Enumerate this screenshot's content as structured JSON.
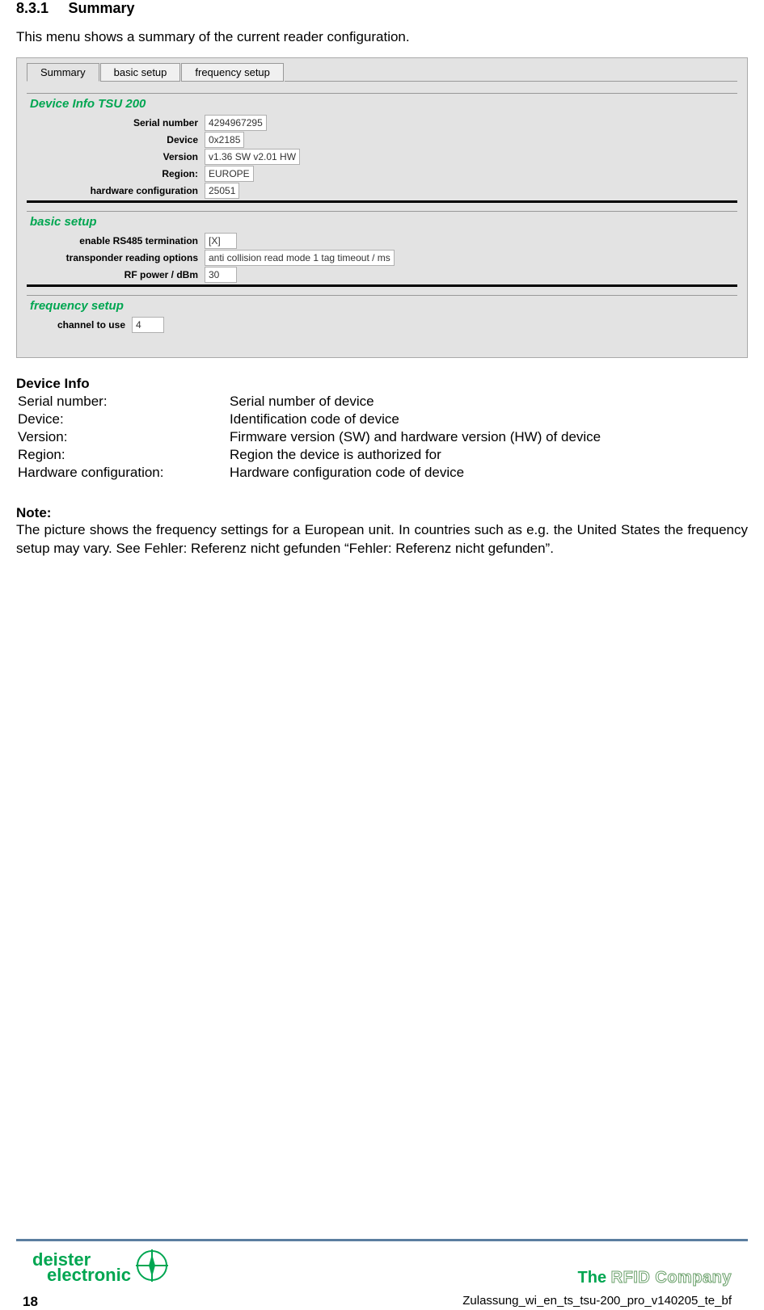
{
  "section": {
    "number": "8.3.1",
    "title": "Summary",
    "intro": "This menu shows a summary of the current reader configuration."
  },
  "tabs": {
    "summary": "Summary",
    "basic": "basic setup",
    "freq": "frequency setup"
  },
  "device_info": {
    "title": "Device Info TSU 200",
    "rows": {
      "serial_label": "Serial number",
      "serial_val": "4294967295",
      "device_label": "Device",
      "device_val": "0x2185",
      "version_label": "Version",
      "version_val": "v1.36 SW v2.01 HW",
      "region_label": "Region:",
      "region_val": "EUROPE",
      "hw_label": "hardware configuration",
      "hw_val": "25051"
    }
  },
  "basic_setup": {
    "title": "basic setup",
    "rows": {
      "rs485_label": "enable RS485 termination",
      "rs485_val": "[X]",
      "trans_label": "transponder reading options",
      "trans_val": "anti collision read mode 1 tag timeout / ms",
      "rf_label": "RF power / dBm",
      "rf_val": "30"
    }
  },
  "freq_setup": {
    "title": "frequency setup",
    "channel_label": "channel to use",
    "channel_val": "4"
  },
  "defs": {
    "heading": "Device Info",
    "rows": [
      {
        "label": "Serial number:",
        "desc": "Serial number of device"
      },
      {
        "label": "Device:",
        "desc": "Identification code of device"
      },
      {
        "label": "Version:",
        "desc": "Firmware version (SW) and hardware version (HW) of device"
      },
      {
        "label": "Region:",
        "desc": "Region the device is authorized for"
      },
      {
        "label": "Hardware configuration:",
        "desc": "Hardware configuration code of device"
      }
    ]
  },
  "note": {
    "heading": "Note:",
    "text": "The picture shows the frequency settings for a European unit. In countries such as e.g. the United States the frequency setup may vary. See Fehler: Referenz nicht gefunden “Fehler: Referenz nicht gefunden”."
  },
  "footer": {
    "brand_line1": "deister",
    "brand_line2": "electronic",
    "tag_the": "The ",
    "tag_rest": "RFID Company",
    "page": "18",
    "docref": "Zulassung_wi_en_ts_tsu-200_pro_v140205_te_bf"
  }
}
